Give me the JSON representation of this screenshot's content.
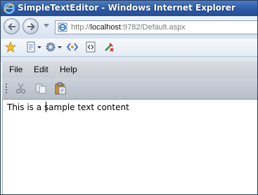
{
  "window": {
    "title": "SimpleTextEditor - Windows Internet Explorer"
  },
  "address": {
    "prefix": "http://",
    "host": "localhost",
    "rest": ":9782/Default.aspx"
  },
  "icons": {
    "browser": "ie-logo-icon",
    "back": "back-arrow-icon",
    "forward": "forward-arrow-icon",
    "favorites": "star-icon",
    "page": "page-icon",
    "tools": "gear-icon",
    "script": "script-debug-icon",
    "source": "html-source-icon",
    "report": "report-issue-icon",
    "cut": "scissors-icon",
    "copy": "copy-icon",
    "paste": "paste-icon"
  },
  "menu": {
    "items": [
      "File",
      "Edit",
      "Help"
    ]
  },
  "editor": {
    "content": "This is a sample text content"
  },
  "colors": {
    "titlebar": "#2b5aa6",
    "menubar": "#cfd3d9",
    "toolbar": "#c2c8d1"
  }
}
